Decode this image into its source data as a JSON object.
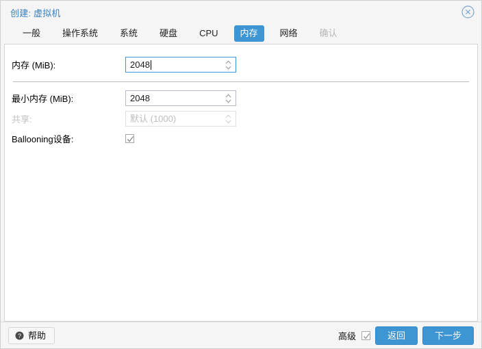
{
  "window": {
    "title": "创建: 虚拟机",
    "close_icon": "close-circle-icon"
  },
  "tabs": [
    {
      "label": "一般",
      "state": "normal"
    },
    {
      "label": "操作系统",
      "state": "normal"
    },
    {
      "label": "系统",
      "state": "normal"
    },
    {
      "label": "硬盘",
      "state": "normal"
    },
    {
      "label": "CPU",
      "state": "normal"
    },
    {
      "label": "内存",
      "state": "active"
    },
    {
      "label": "网络",
      "state": "normal"
    },
    {
      "label": "确认",
      "state": "disabled"
    }
  ],
  "form": {
    "memory": {
      "label": "内存 (MiB):",
      "value": "2048",
      "placeholder": ""
    },
    "min_memory": {
      "label": "最小内存 (MiB):",
      "value": "2048",
      "placeholder": ""
    },
    "shares": {
      "label": "共享:",
      "value": "",
      "placeholder": "默认 (1000)"
    },
    "ballooning": {
      "label": "Ballooning设备:",
      "checked": "checked"
    }
  },
  "footer": {
    "help_label": "帮助",
    "help_icon": "question-circle-icon",
    "advanced_label": "高级",
    "advanced_checked": "checked",
    "back_label": "返回",
    "next_label": "下一步"
  },
  "colors": {
    "accent": "#3e95d4",
    "title": "#3a7fc1",
    "panel": "#ffffff",
    "chrome": "#f5f5f5",
    "disabled_text": "#b7b7b7"
  }
}
